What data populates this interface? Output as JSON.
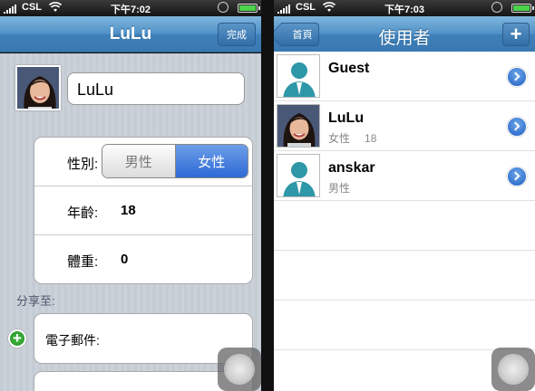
{
  "left_screen": {
    "status": {
      "carrier": "CSL",
      "time": "下午7:02",
      "battery_level": 1.0
    },
    "navbar": {
      "title": "LuLu",
      "done_label": "完成"
    },
    "name_field": {
      "value": "LuLu"
    },
    "gender": {
      "label": "性別:",
      "options": [
        "男性",
        "女性"
      ],
      "selected": "女性"
    },
    "age": {
      "label": "年齡:",
      "value": "18"
    },
    "weight": {
      "label": "體重:",
      "value": "0"
    },
    "share_section": {
      "label": "分享至:",
      "email_label": "電子郵件:"
    }
  },
  "right_screen": {
    "status": {
      "carrier": "CSL",
      "time": "下午7:03",
      "battery_level": 1.0
    },
    "navbar": {
      "title": "使用者",
      "back_label": "首頁",
      "add_label": "+"
    },
    "users": [
      {
        "name": "Guest",
        "gender": "",
        "age": "",
        "avatar": "silhouette-icon"
      },
      {
        "name": "LuLu",
        "gender": "女性",
        "age": "18",
        "avatar": "photo"
      },
      {
        "name": "anskar",
        "gender": "男性",
        "age": "",
        "avatar": "silhouette-icon"
      }
    ]
  },
  "colors": {
    "navbar": "#4f90c6",
    "segment_selected": "#2e6ad6",
    "disclosure": "#1f5fc4",
    "add_green": "#1e8a1e"
  }
}
